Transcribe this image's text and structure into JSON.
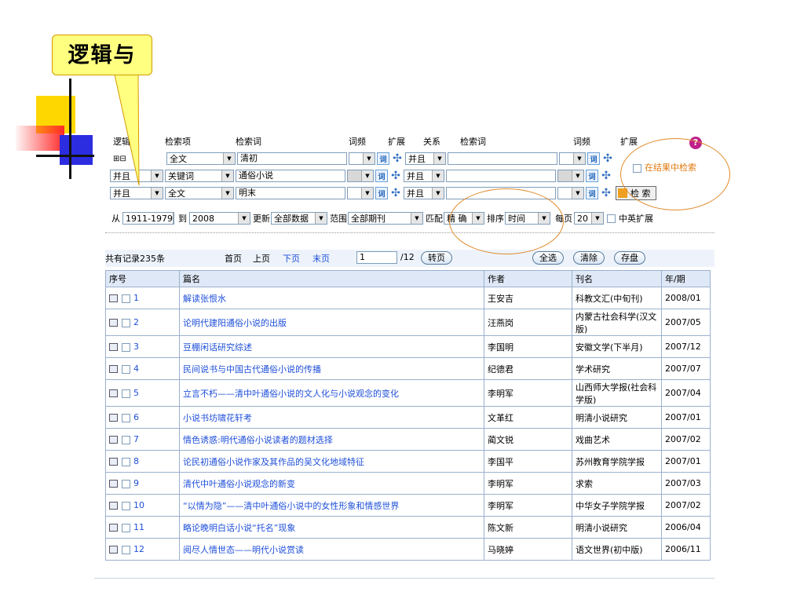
{
  "callout": {
    "text": "逻辑与"
  },
  "form": {
    "headers": {
      "logic": "逻辑",
      "field": "检索项",
      "term": "检索词",
      "freq": "词频",
      "expand": "扩展",
      "relation": "关系",
      "term2": "检索词",
      "freq2": "词频",
      "expand2": "扩展"
    },
    "plus_minus": "⊞⊟",
    "rows": [
      {
        "logic": "",
        "field": "全文",
        "term": "清初",
        "relation": "并且"
      },
      {
        "logic": "并且",
        "field": "关键词",
        "term": "通俗小说",
        "relation": "并且"
      },
      {
        "logic": "并且",
        "field": "全文",
        "term": "明末",
        "relation": "并且"
      }
    ],
    "within_results": "在结果中检索",
    "search_button": "检 索",
    "filters": {
      "from_label": "从",
      "from_value": "1911-1979",
      "to_label": "到",
      "to_value": "2008",
      "update_label": "更新",
      "update_value": "全部数据",
      "scope_label": "范围",
      "scope_value": "全部期刊",
      "match_label": "匹配",
      "match_value": "精 确",
      "sort_label": "排序",
      "sort_value": "时间",
      "per_page_label": "每页",
      "per_page_value": "20",
      "cn_en_label": "中英扩展"
    }
  },
  "pager": {
    "total": "共有记录235条",
    "first": "首页",
    "prev": "上页",
    "next": "下页",
    "last": "末页",
    "page_input": "1",
    "page_total": "/12",
    "goto": "转页",
    "select_all": "全选",
    "clear": "清除",
    "save": "存盘"
  },
  "table": {
    "headers": [
      "序号",
      "篇名",
      "作者",
      "刊名",
      "年/期"
    ],
    "rows": [
      {
        "no": "1",
        "title": "解读张恨水",
        "author": "王安吉",
        "journal": "科教文汇(中旬刊)",
        "issue": "2008/01"
      },
      {
        "no": "2",
        "title": "论明代建阳通俗小说的出版",
        "author": "汪燕岗",
        "journal": "内蒙古社会科学(汉文版)",
        "issue": "2007/05"
      },
      {
        "no": "3",
        "title": "豆棚闲话研究综述",
        "author": "李国明",
        "journal": "安徽文学(下半月)",
        "issue": "2007/12"
      },
      {
        "no": "4",
        "title": "民间说书与中国古代通俗小说的传播",
        "author": "纪德君",
        "journal": "学术研究",
        "issue": "2007/07"
      },
      {
        "no": "5",
        "title": "立言不朽——清中叶通俗小说的文人化与小说观念的变化",
        "author": "李明军",
        "journal": "山西师大学报(社会科学版)",
        "issue": "2007/04"
      },
      {
        "no": "6",
        "title": "小说书坊啸花轩考",
        "author": "文革红",
        "journal": "明清小说研究",
        "issue": "2007/01"
      },
      {
        "no": "7",
        "title": "情色诱惑:明代通俗小说读者的题材选择",
        "author": "蔺文锐",
        "journal": "戏曲艺术",
        "issue": "2007/02"
      },
      {
        "no": "8",
        "title": "论民初通俗小说作家及其作品的吴文化地域特征",
        "author": "李国平",
        "journal": "苏州教育学院学报",
        "issue": "2007/01"
      },
      {
        "no": "9",
        "title": "清代中叶通俗小说观念的新变",
        "author": "李明军",
        "journal": "求索",
        "issue": "2007/03"
      },
      {
        "no": "10",
        "title": "“以情为隐”——清中叶通俗小说中的女性形象和情感世界",
        "author": "李明军",
        "journal": "中华女子学院学报",
        "issue": "2007/02"
      },
      {
        "no": "11",
        "title": "略论晚明白话小说“托名”现象",
        "author": "陈文新",
        "journal": "明清小说研究",
        "issue": "2006/04"
      },
      {
        "no": "12",
        "title": "阅尽人情世态——明代小说赏读",
        "author": "马晓婷",
        "journal": "语文世界(初中版)",
        "issue": "2006/11"
      }
    ]
  }
}
